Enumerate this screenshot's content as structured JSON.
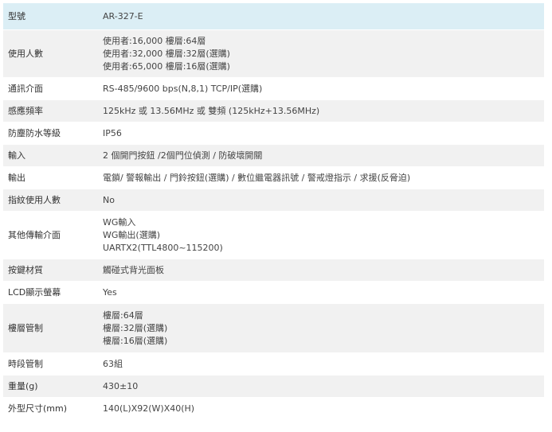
{
  "spec_table": {
    "rows": [
      {
        "label": "型號",
        "lines": [
          "AR-327-E"
        ]
      },
      {
        "label": "使用人數",
        "lines": [
          "使用者:16,000 樓層:64層",
          "使用者:32,000 樓層:32層(選購)",
          "使用者:65,000 樓層:16層(選購)"
        ]
      },
      {
        "label": "通訊介面",
        "lines": [
          "RS-485/9600 bps(N,8,1) TCP/IP(選購)"
        ]
      },
      {
        "label": "感應頻率",
        "lines": [
          "125kHz 或 13.56MHz 或 雙頻 (125kHz+13.56MHz)"
        ]
      },
      {
        "label": "防塵防水等級",
        "lines": [
          "IP56"
        ]
      },
      {
        "label": "輸入",
        "lines": [
          "2 個開門按鈕 /2個門位偵測 / 防破壞開關"
        ]
      },
      {
        "label": "輸出",
        "lines": [
          "電鎖/ 警報輸出 / 門鈴按鈕(選購) / 數位繼電器訊號 / 警戒燈指示 / 求援(反脅迫)"
        ]
      },
      {
        "label": "指紋使用人數",
        "lines": [
          "No"
        ]
      },
      {
        "label": "其他傳輸介面",
        "lines": [
          "WG輸入",
          "WG輸出(選購)",
          "UARTX2(TTL4800~115200)"
        ]
      },
      {
        "label": "按鍵材質",
        "lines": [
          "觸碰式背光面板"
        ]
      },
      {
        "label": "LCD顯示螢幕",
        "lines": [
          "Yes"
        ]
      },
      {
        "label": "樓層管制",
        "lines": [
          "樓層:64層",
          "樓層:32層(選購)",
          "樓層:16層(選購)"
        ]
      },
      {
        "label": "時段管制",
        "lines": [
          "63組"
        ]
      },
      {
        "label": "重量(g)",
        "lines": [
          "430±10"
        ]
      },
      {
        "label": "外型尺寸(mm)",
        "lines": [
          "140(L)X92(W)X40(H)"
        ]
      }
    ]
  }
}
